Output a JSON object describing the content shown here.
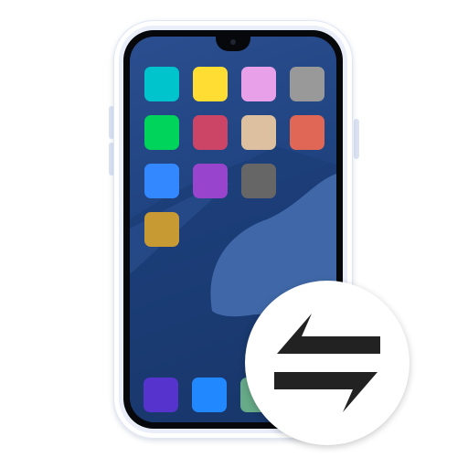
{
  "phone": {
    "screen_colors": {
      "wallpaper_top": "#2a4e8f",
      "wallpaper_bottom": "#16325f",
      "wallpaper_shape": "#4068a8"
    },
    "home_apps": [
      {
        "name": "app-1",
        "color": "#00c4cc"
      },
      {
        "name": "app-2",
        "color": "#ffdd33"
      },
      {
        "name": "app-3",
        "color": "#e8a0e8"
      },
      {
        "name": "app-4",
        "color": "#999999"
      },
      {
        "name": "app-5",
        "color": "#00d45a"
      },
      {
        "name": "app-6",
        "color": "#cc4466"
      },
      {
        "name": "app-7",
        "color": "#dcc0a0"
      },
      {
        "name": "app-8",
        "color": "#e06655"
      },
      {
        "name": "app-9",
        "color": "#3388ff"
      },
      {
        "name": "app-10",
        "color": "#9944cc"
      },
      {
        "name": "app-11",
        "color": "#666666"
      },
      {
        "name": "app-12",
        "color": "#c89a33"
      }
    ],
    "dock_apps": [
      {
        "name": "dock-app-1",
        "color": "#5533cc"
      },
      {
        "name": "dock-app-2",
        "color": "#2288ff"
      },
      {
        "name": "dock-app-3",
        "color": "#66aa88"
      }
    ]
  },
  "badge": {
    "icon": "transfer-arrows-icon",
    "icon_color": "#222222",
    "background": "#ffffff"
  }
}
